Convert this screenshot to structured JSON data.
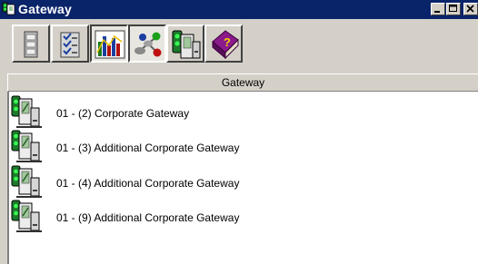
{
  "window": {
    "title": "Gateway",
    "controls": [
      "minimize",
      "maximize",
      "close"
    ]
  },
  "toolbar": {
    "buttons": [
      {
        "icon": "device-list-icon",
        "pressed": false
      },
      {
        "icon": "checklist-icon",
        "pressed": false
      },
      {
        "icon": "bar-chart-icon",
        "pressed": true
      },
      {
        "icon": "network-nodes-icon",
        "pressed": true
      },
      {
        "icon": "gateway-device-icon",
        "pressed": false
      },
      {
        "icon": "help-book-icon",
        "pressed": false
      }
    ]
  },
  "list": {
    "header": "Gateway",
    "items": [
      {
        "label": "01 - (2)  Corporate Gateway",
        "icon": "gateway-icon"
      },
      {
        "label": "01 - (3)  Additional Corporate Gateway",
        "icon": "gateway-icon"
      },
      {
        "label": "01 - (4)  Additional Corporate Gateway",
        "icon": "gateway-icon"
      },
      {
        "label": "01 - (9)  Additional Corporate Gateway",
        "icon": "gateway-icon"
      }
    ]
  },
  "colors": {
    "titlebar": "#0a246a",
    "face": "#d4d0c8",
    "list_bg": "#ffffff"
  }
}
